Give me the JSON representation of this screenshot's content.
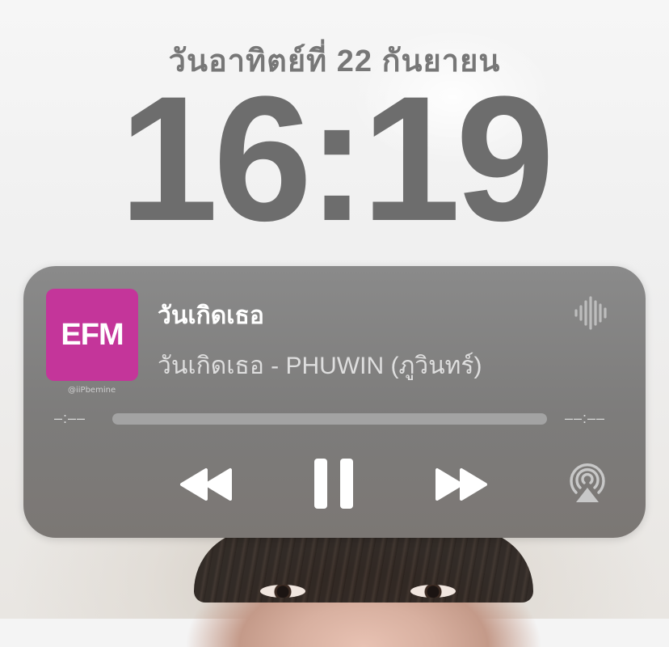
{
  "lockscreen": {
    "date": "วันอาทิตย์ที่ 22 กันยายน",
    "time": "16:19"
  },
  "now_playing": {
    "artwork_text": "EFM",
    "artwork_color": "#c4359a",
    "watermark": "@iiPbemine",
    "title": "วันเกิดเธอ",
    "subtitle": "วันเกิดเธอ - PHUWIN (ภูวินทร์)",
    "elapsed": "–:––",
    "remaining": "––:––",
    "progress": 0,
    "icons": {
      "waveform": "waveform-icon",
      "rewind": "rewind-icon",
      "pause": "pause-icon",
      "forward": "fast-forward-icon",
      "airplay": "airplay-icon"
    }
  }
}
